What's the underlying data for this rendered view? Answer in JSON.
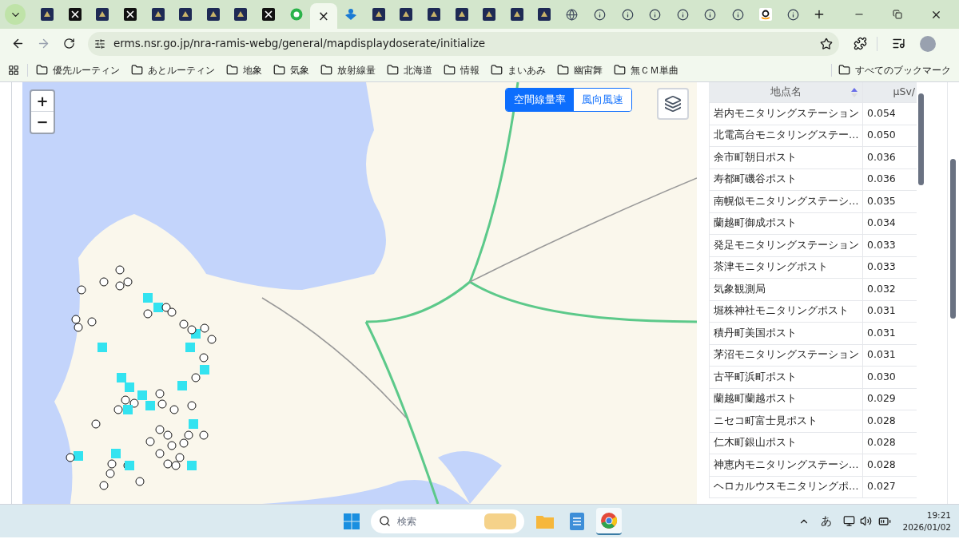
{
  "browser": {
    "tabs": [
      {
        "kind": "app",
        "selected": false
      },
      {
        "kind": "x",
        "selected": false
      },
      {
        "kind": "app",
        "selected": false
      },
      {
        "kind": "x",
        "selected": false
      },
      {
        "kind": "app",
        "selected": false
      },
      {
        "kind": "app",
        "selected": false
      },
      {
        "kind": "app",
        "selected": false
      },
      {
        "kind": "app",
        "selected": false
      },
      {
        "kind": "x",
        "selected": false
      },
      {
        "kind": "ring",
        "selected": false
      },
      {
        "selected": true
      },
      {
        "kind": "person",
        "selected": false
      },
      {
        "kind": "app",
        "selected": false
      },
      {
        "kind": "app",
        "selected": false
      },
      {
        "kind": "app",
        "selected": false
      },
      {
        "kind": "app",
        "selected": false
      },
      {
        "kind": "app",
        "selected": false
      },
      {
        "kind": "app",
        "selected": false
      },
      {
        "kind": "app",
        "selected": false
      },
      {
        "kind": "globe",
        "selected": false
      },
      {
        "kind": "info",
        "selected": false
      },
      {
        "kind": "info",
        "selected": false
      },
      {
        "kind": "info",
        "selected": false
      },
      {
        "kind": "info",
        "selected": false
      },
      {
        "kind": "info",
        "selected": false
      },
      {
        "kind": "info",
        "selected": false
      },
      {
        "kind": "smile",
        "selected": false
      },
      {
        "kind": "info",
        "selected": false
      }
    ],
    "close_tab": "×",
    "address": "erms.nsr.go.jp/nra-ramis-webg/general/mapdisplaydoserate/initialize",
    "bookmarks": [
      {
        "label": "優先ルーティン"
      },
      {
        "label": "あとルーティン"
      },
      {
        "label": "地象"
      },
      {
        "label": "気象"
      },
      {
        "label": "放射線量"
      },
      {
        "label": "北海道"
      },
      {
        "label": "情報"
      },
      {
        "label": "まいあみ"
      },
      {
        "label": "幽宙舞"
      },
      {
        "label": "無ＣＭ単曲"
      }
    ],
    "all_bookmarks": "すべてのブックマーク"
  },
  "map": {
    "zoom_in": "+",
    "zoom_out": "−",
    "layers": [
      {
        "label": "空間線量率",
        "selected": true
      },
      {
        "label": "風向風速",
        "selected": false
      }
    ]
  },
  "table": {
    "columns": [
      {
        "label": "地点名",
        "sorted": true
      },
      {
        "label": "μSv/"
      }
    ],
    "rows": [
      {
        "name": "岩内モニタリングステーション",
        "value": "0.054"
      },
      {
        "name": "北電高台モニタリングステー…",
        "value": "0.050"
      },
      {
        "name": "余市町朝日ポスト",
        "value": "0.036"
      },
      {
        "name": "寿都町磯谷ポスト",
        "value": "0.036"
      },
      {
        "name": "南幌似モニタリングステーシ…",
        "value": "0.035"
      },
      {
        "name": "蘭越町御成ポスト",
        "value": "0.034"
      },
      {
        "name": "発足モニタリングステーション",
        "value": "0.033"
      },
      {
        "name": "茶津モニタリングポスト",
        "value": "0.033"
      },
      {
        "name": "気象観測局",
        "value": "0.032"
      },
      {
        "name": "堀株神社モニタリングポスト",
        "value": "0.031"
      },
      {
        "name": "積丹町美国ポスト",
        "value": "0.031"
      },
      {
        "name": "茅沼モニタリングステーション",
        "value": "0.031"
      },
      {
        "name": "古平町浜町ポスト",
        "value": "0.030"
      },
      {
        "name": "蘭越町蘭越ポスト",
        "value": "0.029"
      },
      {
        "name": "ニセコ町富士見ポスト",
        "value": "0.028"
      },
      {
        "name": "仁木町銀山ポスト",
        "value": "0.028"
      },
      {
        "name": "神恵内モニタリングステーシ…",
        "value": "0.028"
      },
      {
        "name": "ヘロカルウスモニタリングポ…",
        "value": "0.027"
      }
    ]
  },
  "taskbar": {
    "search_placeholder": "検索",
    "apps": [
      {
        "kind": "folder",
        "selected": false
      },
      {
        "kind": "notepad",
        "selected": false
      },
      {
        "kind": "chrome",
        "selected": true
      }
    ],
    "ime": "あ",
    "time": "19:21",
    "date": "2026/01/02"
  }
}
